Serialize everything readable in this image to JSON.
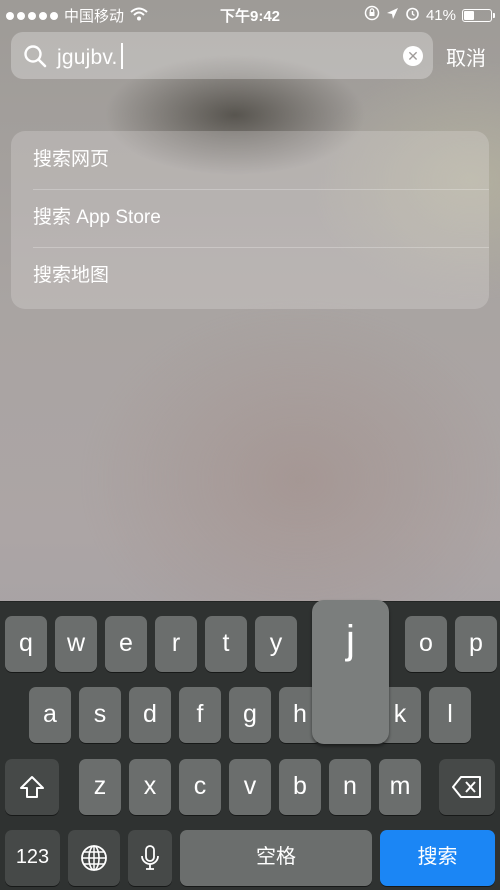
{
  "status_bar": {
    "carrier": "中国移动",
    "time": "下午9:42",
    "battery_percent": "41%",
    "battery_level": 0.41,
    "icons": [
      "signal-dots-icon",
      "wifi-icon",
      "rotation-lock-icon",
      "location-icon",
      "alarm-icon",
      "battery-icon"
    ]
  },
  "search": {
    "query": "jgujbv.",
    "cancel_label": "取消"
  },
  "suggestions": [
    {
      "label": "搜索网页"
    },
    {
      "label": "搜索 App Store"
    },
    {
      "label": "搜索地图"
    }
  ],
  "keyboard": {
    "row1": [
      "q",
      "w",
      "e",
      "r",
      "t",
      "y",
      "j",
      "o",
      "p"
    ],
    "row2": [
      "a",
      "s",
      "d",
      "f",
      "g",
      "h",
      "k",
      "l"
    ],
    "row3": [
      "z",
      "x",
      "c",
      "v",
      "b",
      "n",
      "m"
    ],
    "numbers_label": "123",
    "space_label": "空格",
    "search_label": "搜索",
    "popup_letter": "j",
    "special_icons": [
      "shift-icon",
      "backspace-icon",
      "globe-icon",
      "microphone-icon"
    ],
    "colors": {
      "background": "#2f3231",
      "key": "#6b6e6d",
      "dark_key": "#464948",
      "accent": "#1b86f5"
    }
  }
}
